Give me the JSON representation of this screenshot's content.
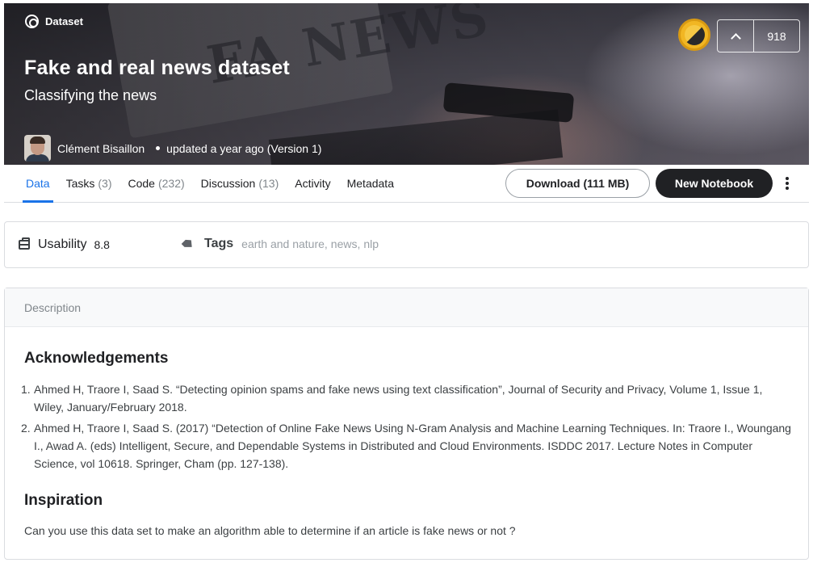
{
  "hero": {
    "type_label": "Dataset",
    "title": "Fake and real news dataset",
    "subtitle": "Classifying the news",
    "author": "Clément Bisaillon",
    "updated": "updated a year ago (Version 1)",
    "medal_color": "#f1b623",
    "votes": "918"
  },
  "tabs": [
    {
      "label": "Data",
      "count": ""
    },
    {
      "label": "Tasks",
      "count": "(3)"
    },
    {
      "label": "Code",
      "count": "(232)"
    },
    {
      "label": "Discussion",
      "count": "(13)"
    },
    {
      "label": "Activity",
      "count": ""
    },
    {
      "label": "Metadata",
      "count": ""
    }
  ],
  "actions": {
    "download_label": "Download (111 MB)",
    "new_notebook_label": "New Notebook"
  },
  "usability": {
    "label": "Usability",
    "value": "8.8"
  },
  "tags": {
    "label": "Tags",
    "items": [
      "earth and nature",
      "news",
      "nlp"
    ]
  },
  "description": {
    "header": "Description",
    "acknowledgements_title": "Acknowledgements",
    "references": [
      {
        "num": "1.",
        "text": "Ahmed H, Traore I, Saad S. “Detecting opinion spams and fake news using text classification”, Journal of Security and Privacy, Volume 1, Issue 1, Wiley, January/February 2018."
      },
      {
        "num": "2.",
        "text": "Ahmed H, Traore I, Saad S. (2017) “Detection of Online Fake News Using N-Gram Analysis and Machine Learning Techniques. In: Traore I., Woungang I., Awad A. (eds) Intelligent, Secure, and Dependable Systems in Distributed and Cloud Environments. ISDDC 2017. Lecture Notes in Computer Science, vol 10618. Springer, Cham (pp. 127-138)."
      }
    ],
    "inspiration_title": "Inspiration",
    "inspiration_text": "Can you use this data set to make an algorithm able to determine if an article is fake news or not ?"
  },
  "colors": {
    "accent": "#1a73e8",
    "primary_button": "#202124"
  }
}
